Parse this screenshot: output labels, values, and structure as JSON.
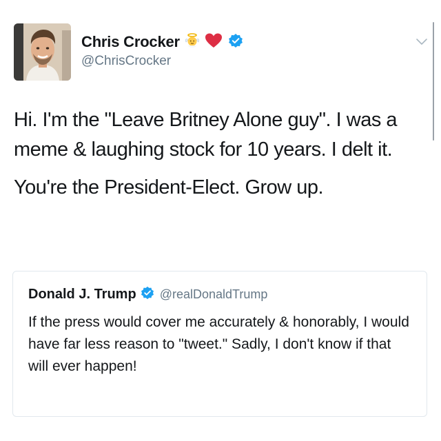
{
  "author": {
    "display_name": "Chris Crocker",
    "handle": "@ChrisCrocker",
    "name_emojis": [
      "baby-angel-emoji",
      "red-heart-emoji"
    ],
    "verified": true
  },
  "tweet": {
    "paragraphs": [
      "Hi. I'm the \"Leave Britney Alone guy\". I was a meme & laughing stock for 10 years. I delt it.",
      "You're the President-Elect. Grow up."
    ]
  },
  "quoted_tweet": {
    "display_name": "Donald J. Trump",
    "handle": "@realDonaldTrump",
    "verified": true,
    "text": "If the press would cover me accurately & honorably, I would have far less reason to \"tweet.\" Sadly, I don't know if that will ever happen!"
  },
  "icons": {
    "more_menu": "chevron-down-icon",
    "verified": "verified-badge-icon"
  },
  "colors": {
    "verified_blue": "#1da1f2",
    "heart_red": "#e0245e",
    "secondary_text": "#657786",
    "border": "#e1e8ed"
  }
}
